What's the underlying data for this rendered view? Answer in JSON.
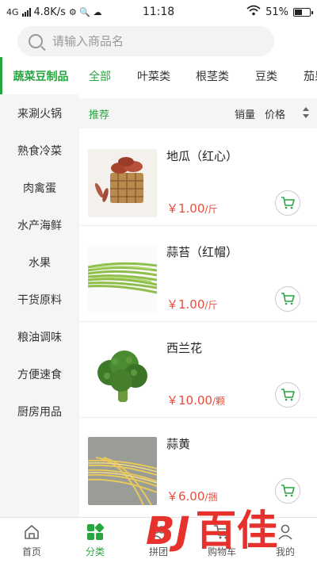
{
  "status_bar": {
    "network": "4G",
    "speed": "4.8K/s",
    "time": "11:18",
    "battery": "51%",
    "battery_level": 0.51
  },
  "search": {
    "placeholder": "请输入商品名"
  },
  "sidebar": {
    "items": [
      {
        "label": "蔬菜豆制品",
        "active": true
      },
      {
        "label": "来涮火锅"
      },
      {
        "label": "熟食冷菜"
      },
      {
        "label": "肉禽蛋"
      },
      {
        "label": "水产海鲜"
      },
      {
        "label": "水果"
      },
      {
        "label": "干货原料"
      },
      {
        "label": "粮油调味"
      },
      {
        "label": "方便速食"
      },
      {
        "label": "厨房用品"
      }
    ]
  },
  "categories": {
    "items": [
      {
        "label": "全部",
        "active": true
      },
      {
        "label": "叶菜类"
      },
      {
        "label": "根茎类"
      },
      {
        "label": "豆类"
      },
      {
        "label": "茄果"
      }
    ]
  },
  "sortbar": {
    "recommend": "推荐",
    "sales": "销量",
    "price": "价格"
  },
  "products": [
    {
      "name": "地瓜（红心）",
      "price": "￥1.00",
      "unit": "/斤",
      "icon": "sweet-potato"
    },
    {
      "name": "蒜苔（红帽）",
      "price": "￥1.00",
      "unit": "/斤",
      "icon": "garlic-scape"
    },
    {
      "name": "西兰花",
      "price": "￥10.00",
      "unit": "/颗",
      "icon": "broccoli"
    },
    {
      "name": "蒜黄",
      "price": "￥6.00",
      "unit": "/捆",
      "icon": "yellow-garlic-chives"
    }
  ],
  "bottom_nav": {
    "items": [
      {
        "label": "首页",
        "icon": "home-icon"
      },
      {
        "label": "分类",
        "icon": "category-icon",
        "active": true
      },
      {
        "label": "拼团",
        "icon": "group-buy-icon"
      },
      {
        "label": "购物车",
        "icon": "cart-icon"
      },
      {
        "label": "我的",
        "icon": "user-icon"
      }
    ]
  },
  "watermark": {
    "logo": "BJ",
    "text": "百佳"
  },
  "colors": {
    "accent": "#27a640",
    "price": "#e64d3d",
    "watermark": "#e7312c"
  }
}
